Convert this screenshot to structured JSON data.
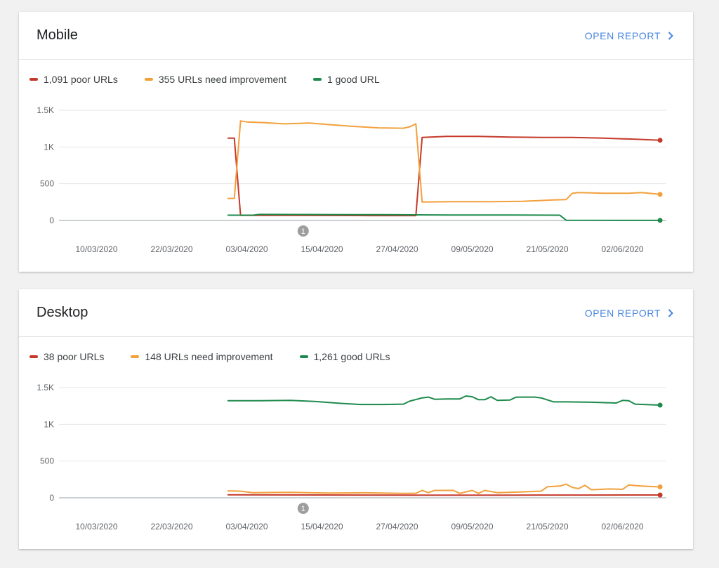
{
  "mobile": {
    "title": "Mobile",
    "open_report_label": "OPEN REPORT",
    "legend": [
      {
        "label": "1,091 poor URLs",
        "color": "#c5392a"
      },
      {
        "label": "355 URLs need improvement",
        "color": "#f2a03c"
      },
      {
        "label": "1 good URL",
        "color": "#1e8a4c"
      }
    ]
  },
  "desktop": {
    "title": "Desktop",
    "open_report_label": "OPEN REPORT",
    "legend": [
      {
        "label": "38 poor URLs",
        "color": "#c5392a"
      },
      {
        "label": "148 URLs need improvement",
        "color": "#f2a03c"
      },
      {
        "label": "1,261 good URLs",
        "color": "#1e8a4c"
      }
    ]
  },
  "chart_data": [
    {
      "type": "line",
      "title": "Mobile",
      "ylim": [
        0,
        1500
      ],
      "y_ticks": [
        0,
        500,
        1000,
        1500
      ],
      "y_tick_labels": [
        "0",
        "500",
        "1K",
        "1.5K"
      ],
      "x_tick_labels": [
        "10/03/2020",
        "22/03/2020",
        "03/04/2020",
        "15/04/2020",
        "27/04/2020",
        "09/05/2020",
        "21/05/2020",
        "02/06/2020"
      ],
      "x_range": [
        "2020-03-04",
        "2020-06-09"
      ],
      "grid": true,
      "legend_position": "top-left",
      "annotation": {
        "label": "1",
        "date": "2020-04-12"
      },
      "series": [
        {
          "name": "1,091 poor URLs",
          "color": "#c5392a",
          "points": [
            [
              "2020-03-31",
              1120
            ],
            [
              "2020-04-01",
              1120
            ],
            [
              "2020-04-02",
              70
            ],
            [
              "2020-04-09",
              70
            ],
            [
              "2020-04-16",
              68
            ],
            [
              "2020-04-23",
              66
            ],
            [
              "2020-04-30",
              66
            ],
            [
              "2020-05-01",
              1130
            ],
            [
              "2020-05-05",
              1145
            ],
            [
              "2020-05-10",
              1145
            ],
            [
              "2020-05-15",
              1135
            ],
            [
              "2020-05-20",
              1130
            ],
            [
              "2020-05-25",
              1130
            ],
            [
              "2020-05-30",
              1120
            ],
            [
              "2020-06-04",
              1105
            ],
            [
              "2020-06-08",
              1091
            ]
          ]
        },
        {
          "name": "355 URLs need improvement",
          "color": "#f2a03c",
          "points": [
            [
              "2020-03-31",
              300
            ],
            [
              "2020-04-01",
              300
            ],
            [
              "2020-04-02",
              1355
            ],
            [
              "2020-04-03",
              1340
            ],
            [
              "2020-04-06",
              1330
            ],
            [
              "2020-04-09",
              1315
            ],
            [
              "2020-04-13",
              1325
            ],
            [
              "2020-04-16",
              1305
            ],
            [
              "2020-04-20",
              1280
            ],
            [
              "2020-04-24",
              1260
            ],
            [
              "2020-04-28",
              1255
            ],
            [
              "2020-04-29",
              1275
            ],
            [
              "2020-04-30",
              1315
            ],
            [
              "2020-05-01",
              250
            ],
            [
              "2020-05-06",
              255
            ],
            [
              "2020-05-12",
              255
            ],
            [
              "2020-05-17",
              260
            ],
            [
              "2020-05-22",
              280
            ],
            [
              "2020-05-24",
              285
            ],
            [
              "2020-05-25",
              370
            ],
            [
              "2020-05-26",
              380
            ],
            [
              "2020-05-30",
              370
            ],
            [
              "2020-06-03",
              370
            ],
            [
              "2020-06-05",
              380
            ],
            [
              "2020-06-08",
              355
            ]
          ]
        },
        {
          "name": "1 good URL",
          "color": "#1e8a4c",
          "points": [
            [
              "2020-03-31",
              72
            ],
            [
              "2020-04-04",
              72
            ],
            [
              "2020-04-05",
              82
            ],
            [
              "2020-04-15",
              80
            ],
            [
              "2020-04-25",
              78
            ],
            [
              "2020-05-05",
              74
            ],
            [
              "2020-05-15",
              74
            ],
            [
              "2020-05-23",
              72
            ],
            [
              "2020-05-24",
              3
            ],
            [
              "2020-06-08",
              1
            ]
          ]
        }
      ]
    },
    {
      "type": "line",
      "title": "Desktop",
      "ylim": [
        0,
        1500
      ],
      "y_ticks": [
        0,
        500,
        1000,
        1500
      ],
      "y_tick_labels": [
        "0",
        "500",
        "1K",
        "1.5K"
      ],
      "x_tick_labels": [
        "10/03/2020",
        "22/03/2020",
        "03/04/2020",
        "15/04/2020",
        "27/04/2020",
        "09/05/2020",
        "21/05/2020",
        "02/06/2020"
      ],
      "x_range": [
        "2020-03-04",
        "2020-06-09"
      ],
      "grid": true,
      "legend_position": "top-left",
      "annotation": {
        "label": "1",
        "date": "2020-04-12"
      },
      "series": [
        {
          "name": "38 poor URLs",
          "color": "#c5392a",
          "points": [
            [
              "2020-03-31",
              40
            ],
            [
              "2020-04-15",
              38
            ],
            [
              "2020-05-01",
              36
            ],
            [
              "2020-05-15",
              36
            ],
            [
              "2020-05-29",
              37
            ],
            [
              "2020-06-08",
              38
            ]
          ]
        },
        {
          "name": "148 URLs need improvement",
          "color": "#f2a03c",
          "points": [
            [
              "2020-03-31",
              95
            ],
            [
              "2020-04-02",
              90
            ],
            [
              "2020-04-04",
              70
            ],
            [
              "2020-04-10",
              75
            ],
            [
              "2020-04-16",
              65
            ],
            [
              "2020-04-22",
              68
            ],
            [
              "2020-04-28",
              60
            ],
            [
              "2020-04-30",
              62
            ],
            [
              "2020-05-01",
              100
            ],
            [
              "2020-05-02",
              70
            ],
            [
              "2020-05-03",
              100
            ],
            [
              "2020-05-06",
              100
            ],
            [
              "2020-05-07",
              60
            ],
            [
              "2020-05-09",
              100
            ],
            [
              "2020-05-10",
              60
            ],
            [
              "2020-05-11",
              100
            ],
            [
              "2020-05-13",
              70
            ],
            [
              "2020-05-17",
              80
            ],
            [
              "2020-05-20",
              90
            ],
            [
              "2020-05-21",
              150
            ],
            [
              "2020-05-23",
              160
            ],
            [
              "2020-05-24",
              185
            ],
            [
              "2020-05-25",
              140
            ],
            [
              "2020-05-26",
              125
            ],
            [
              "2020-05-27",
              170
            ],
            [
              "2020-05-28",
              110
            ],
            [
              "2020-05-31",
              120
            ],
            [
              "2020-06-02",
              115
            ],
            [
              "2020-06-03",
              175
            ],
            [
              "2020-06-05",
              160
            ],
            [
              "2020-06-08",
              148
            ]
          ]
        },
        {
          "name": "1,261 good URLs",
          "color": "#1e8a4c",
          "points": [
            [
              "2020-03-31",
              1320
            ],
            [
              "2020-04-05",
              1320
            ],
            [
              "2020-04-10",
              1325
            ],
            [
              "2020-04-14",
              1310
            ],
            [
              "2020-04-18",
              1285
            ],
            [
              "2020-04-21",
              1270
            ],
            [
              "2020-04-25",
              1270
            ],
            [
              "2020-04-28",
              1275
            ],
            [
              "2020-04-29",
              1315
            ],
            [
              "2020-05-01",
              1360
            ],
            [
              "2020-05-02",
              1370
            ],
            [
              "2020-05-03",
              1340
            ],
            [
              "2020-05-05",
              1345
            ],
            [
              "2020-05-07",
              1345
            ],
            [
              "2020-05-08",
              1385
            ],
            [
              "2020-05-09",
              1375
            ],
            [
              "2020-05-10",
              1335
            ],
            [
              "2020-05-11",
              1335
            ],
            [
              "2020-05-12",
              1375
            ],
            [
              "2020-05-13",
              1325
            ],
            [
              "2020-05-15",
              1330
            ],
            [
              "2020-05-16",
              1370
            ],
            [
              "2020-05-19",
              1370
            ],
            [
              "2020-05-20",
              1360
            ],
            [
              "2020-05-22",
              1305
            ],
            [
              "2020-05-24",
              1305
            ],
            [
              "2020-05-28",
              1300
            ],
            [
              "2020-06-01",
              1290
            ],
            [
              "2020-06-02",
              1325
            ],
            [
              "2020-06-03",
              1320
            ],
            [
              "2020-06-04",
              1275
            ],
            [
              "2020-06-08",
              1261
            ]
          ]
        }
      ]
    }
  ]
}
